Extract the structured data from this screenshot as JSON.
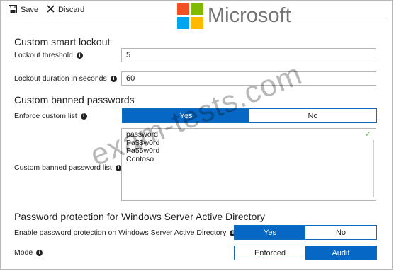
{
  "toolbar": {
    "save_label": "Save",
    "discard_label": "Discard"
  },
  "logo": {
    "text": "Microsoft",
    "colors": [
      "#f25022",
      "#7fba00",
      "#00a4ef",
      "#ffb900"
    ]
  },
  "lockout": {
    "title": "Custom smart lockout",
    "threshold_label": "Lockout threshold",
    "threshold_value": "5",
    "duration_label": "Lockout duration in seconds",
    "duration_value": "60"
  },
  "banned": {
    "title": "Custom banned passwords",
    "enforce_label": "Enforce custom list",
    "enforce_yes": "Yes",
    "enforce_no": "No",
    "enforce_selected": "Yes",
    "list_label": "Custom banned password list",
    "list_items": [
      "password",
      "Pa$$w0rd",
      "Pa55w0rd",
      "Contoso"
    ]
  },
  "ad": {
    "title": "Password protection for Windows Server Active Directory",
    "enable_label": "Enable password protection on Windows Server Active Directory",
    "enable_yes": "Yes",
    "enable_no": "No",
    "enable_selected": "Yes",
    "mode_label": "Mode",
    "mode_enforced": "Enforced",
    "mode_audit": "Audit",
    "mode_selected": "Audit"
  },
  "watermark": "exam-tests.com",
  "accent_color": "#0767c4"
}
